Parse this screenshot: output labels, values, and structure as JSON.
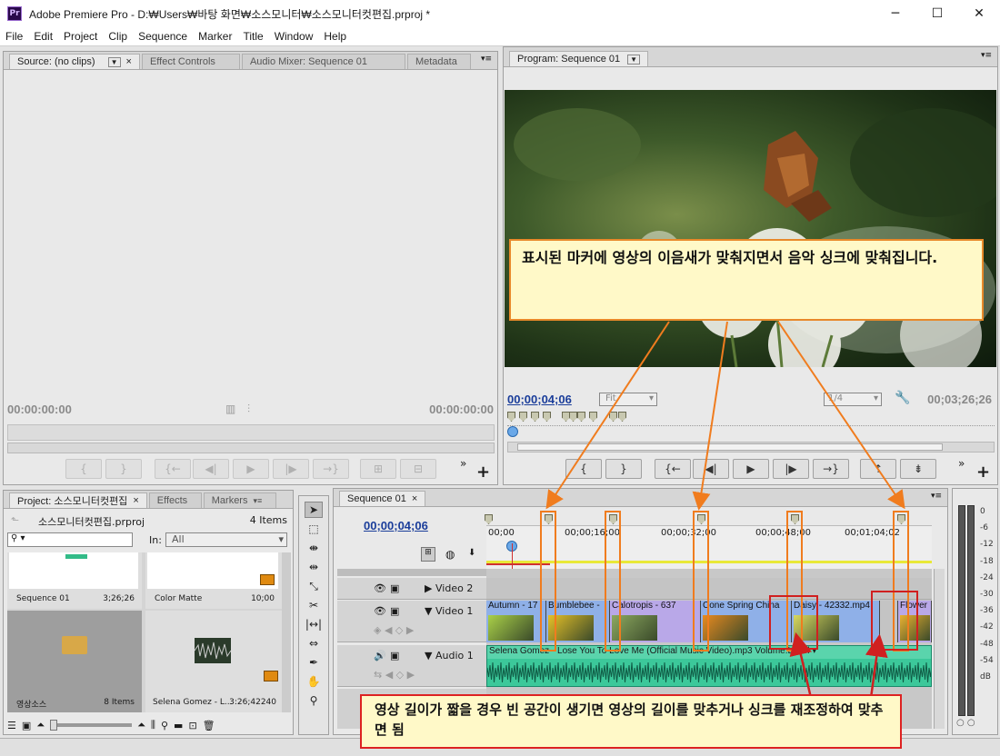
{
  "window": {
    "app_icon": "Pr",
    "title": "Adobe Premiere Pro - D:₩Users₩바탕 화면₩소스모니터₩소스모니터컷편집.prproj *",
    "minimize": "─",
    "maximize": "☐",
    "close": "✕"
  },
  "menu": [
    "File",
    "Edit",
    "Project",
    "Clip",
    "Sequence",
    "Marker",
    "Title",
    "Window",
    "Help"
  ],
  "source_panel": {
    "tabs": [
      "Source: (no clips)",
      "Effect Controls",
      "Audio Mixer: Sequence 01",
      "Metadata"
    ],
    "tc_in": "00:00:00:00",
    "tc_out": "00:00:00:00"
  },
  "program_panel": {
    "tab": "Program: Sequence 01",
    "tc_current": "00;00;04;06",
    "fit": "Fit",
    "quality": "1/4",
    "tc_duration": "00;03;26;26"
  },
  "project_panel": {
    "tabs": [
      "Project: 소스모니터컷편집",
      "Effects",
      "Markers"
    ],
    "project_file": "소스모니터컷편집.prproj",
    "item_count": "4 Items",
    "in_label": "In:",
    "in_value": "All",
    "items": [
      {
        "name": "Sequence 01",
        "meta": "3;26;26"
      },
      {
        "name": "Color Matte",
        "meta": "10;00"
      },
      {
        "name": "영상소스",
        "meta": "8 Items"
      },
      {
        "name": "Selena Gomez - L...",
        "meta": "3:26;42240"
      }
    ]
  },
  "timeline": {
    "tab": "Sequence 01",
    "tc": "00;00;04;06",
    "ruler": [
      "00;00",
      "00;00;16;00",
      "00;00;32;00",
      "00;00;48;00",
      "00;01;04;02"
    ],
    "tracks": {
      "video2": "Video 2",
      "video1": "Video 1",
      "audio1": "Audio 1"
    },
    "clips": [
      "Autumn - 17",
      "Bumblebee -",
      "Calotropis - 637",
      "Cone Spring China",
      "Daisy - 42332.mp4",
      "Flower"
    ],
    "audio_clip": "Selena Gomez - Lose You To Love Me (Official Music Video).mp3",
    "audio_fx": "Volume:Level"
  },
  "meter": {
    "labels": [
      "0",
      "-6",
      "-12",
      "-18",
      "-24",
      "-30",
      "-36",
      "-42",
      "-48",
      "-54",
      "dB"
    ]
  },
  "callouts": {
    "top": "표시된 마커에 영상의 이음새가 맞춰지면서 음악 싱크에 맞춰집니다.",
    "bottom": "영상 길이가 짧을 경우 빈 공간이 생기면 영상의 길이를 맞추거나 싱크를 재조정하여 맞추면 됨"
  },
  "colors": {
    "accent_orange": "#f07c1e",
    "accent_red": "#d02020",
    "timecode_blue": "#1a3d9a",
    "clip_blue": "#8fb0e8",
    "clip_purple": "#b9a8e8",
    "audio_green": "#3cc89a"
  }
}
